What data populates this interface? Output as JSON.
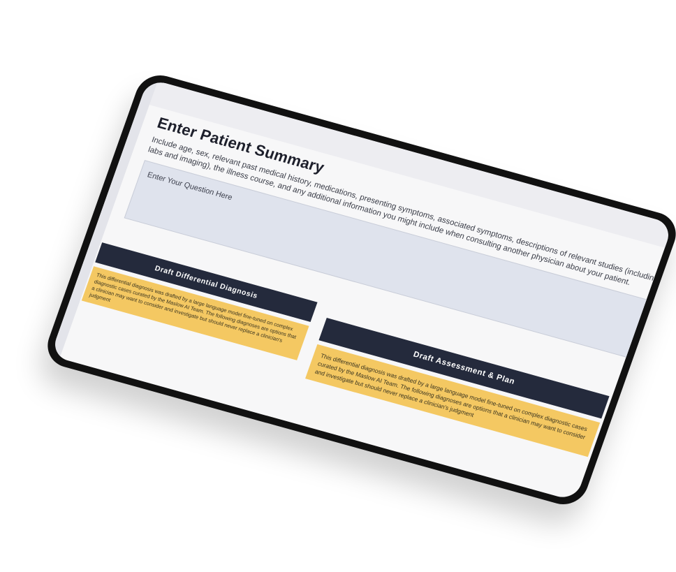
{
  "header": {
    "title": "Enter Patient Summary",
    "description": "Include age, sex, relevant past medical history, medications, presenting symptoms, associated symptoms, descriptions of relevant studies (including labs and imaging), the illness course, and any additional information you might include when consulting another physician about your patient."
  },
  "question": {
    "placeholder": "Enter Your Question Here"
  },
  "panels": {
    "left": {
      "button_label": "Draft Differential Diagnosis",
      "notice": "This differential diagnosis was drafted by a large language model fine-tuned on complex diagnostic cases curated by the Maslow AI Team. The following diagnoses are options that a clinician may want to consider and investigate but should never replace a clinician's judgment"
    },
    "right": {
      "button_label": "Draft Assessment & Plan",
      "notice": "This differential diagnosis was drafted by a large language model fine-tuned on complex diagnostic cases curated by the Maslow AI Team. The following diagnoses are options that a clinician may want to consider and investigate but should never replace a clinician's judgment"
    }
  },
  "colors": {
    "button_bg": "#242a3c",
    "notice_bg": "#f4c862",
    "input_bg": "#dfe3ed",
    "screen_bg": "#f7f7f8",
    "frame": "#111111"
  }
}
